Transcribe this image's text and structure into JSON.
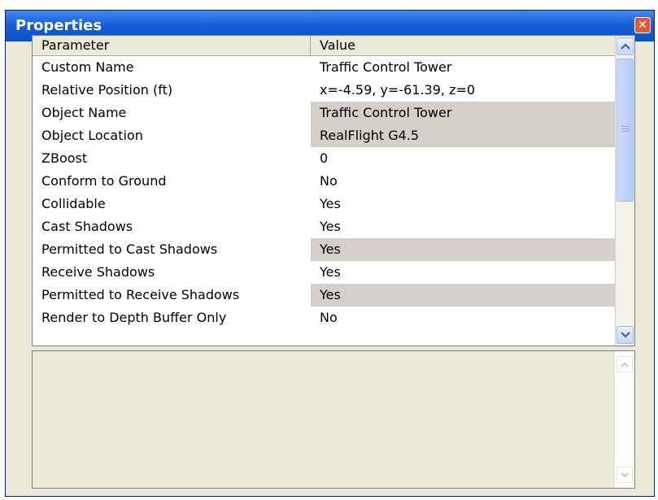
{
  "window": {
    "title": "Properties",
    "close_glyph": "✕"
  },
  "grid": {
    "columns": {
      "parameter": "Parameter",
      "value": "Value"
    },
    "rows": [
      {
        "parameter": "Custom Name",
        "value": "Traffic Control Tower",
        "readonly": false
      },
      {
        "parameter": "Relative Position (ft)",
        "value": "x=-4.59, y=-61.39, z=0",
        "readonly": false
      },
      {
        "parameter": "Object Name",
        "value": "Traffic Control Tower",
        "readonly": true
      },
      {
        "parameter": "Object Location",
        "value": "RealFlight G4.5",
        "readonly": true
      },
      {
        "parameter": "ZBoost",
        "value": "0",
        "readonly": false
      },
      {
        "parameter": "Conform to Ground",
        "value": "No",
        "readonly": false
      },
      {
        "parameter": "Collidable",
        "value": "Yes",
        "readonly": false
      },
      {
        "parameter": "Cast Shadows",
        "value": "Yes",
        "readonly": false
      },
      {
        "parameter": "Permitted to Cast Shadows",
        "value": "Yes",
        "readonly": true
      },
      {
        "parameter": "Receive Shadows",
        "value": "Yes",
        "readonly": false
      },
      {
        "parameter": "Permitted to Receive Shadows",
        "value": "Yes",
        "readonly": true
      },
      {
        "parameter": "Render to Depth Buffer Only",
        "value": "No",
        "readonly": false
      }
    ]
  },
  "scrollbar": {
    "up_icon": "chevron-up-icon",
    "down_icon": "chevron-down-icon"
  },
  "description": {
    "text": ""
  },
  "colors": {
    "titlebar": "#1a5fd8",
    "frame": "#ece9d8",
    "readonly_cell": "#d4d0c8",
    "close_button": "#e5573b"
  }
}
